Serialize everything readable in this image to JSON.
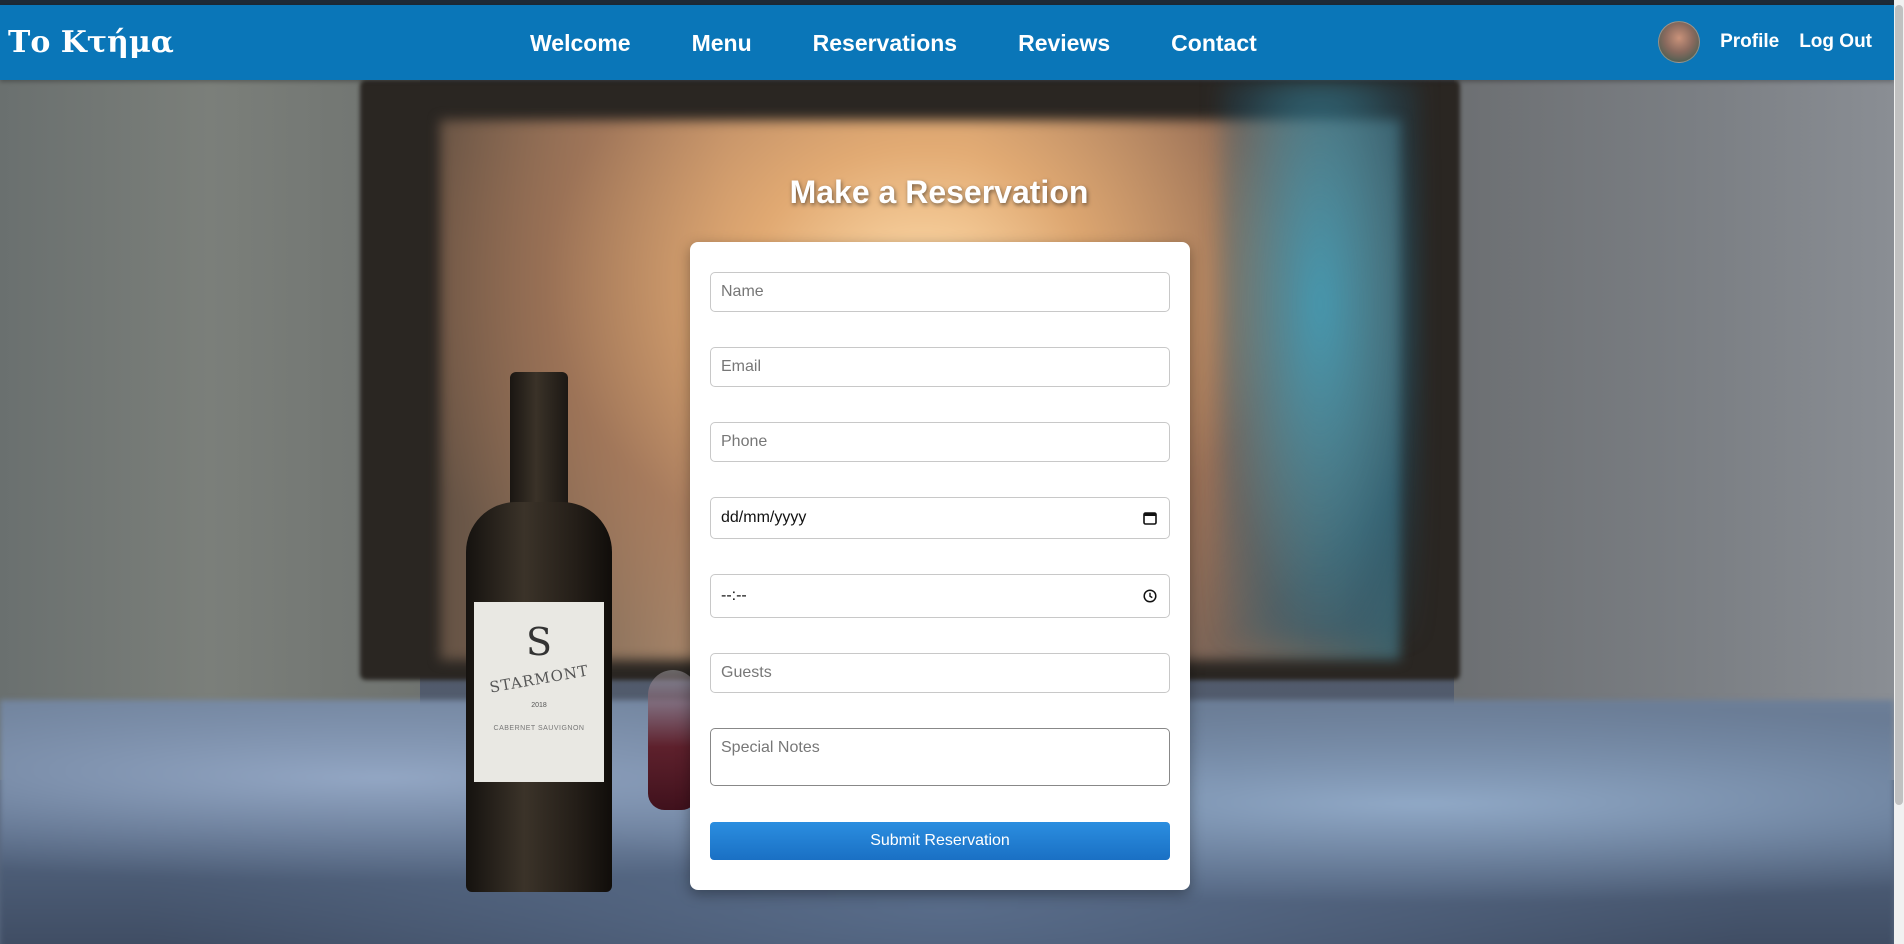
{
  "brand": {
    "name": "Το Κτήμα"
  },
  "nav": {
    "links": [
      {
        "label": "Welcome"
      },
      {
        "label": "Menu"
      },
      {
        "label": "Reservations"
      },
      {
        "label": "Reviews"
      },
      {
        "label": "Contact"
      }
    ],
    "profile_label": "Profile",
    "logout_label": "Log Out"
  },
  "reservation": {
    "title": "Make a Reservation",
    "name_placeholder": "Name",
    "email_placeholder": "Email",
    "phone_placeholder": "Phone",
    "date_value": "dd/mm/yyyy",
    "time_value": "--:--",
    "guests_placeholder": "Guests",
    "notes_placeholder": "Special Notes",
    "submit_label": "Submit Reservation"
  },
  "background": {
    "bottle_logo": "S",
    "bottle_brand": "STARMONT",
    "bottle_year": "2018",
    "bottle_variety": "CABERNET SAUVIGNON"
  },
  "colors": {
    "navbar": "#0a76b8",
    "button": "#1a70c4",
    "card": "#ffffff"
  },
  "icons": {
    "date": "calendar-icon",
    "time": "clock-icon"
  }
}
